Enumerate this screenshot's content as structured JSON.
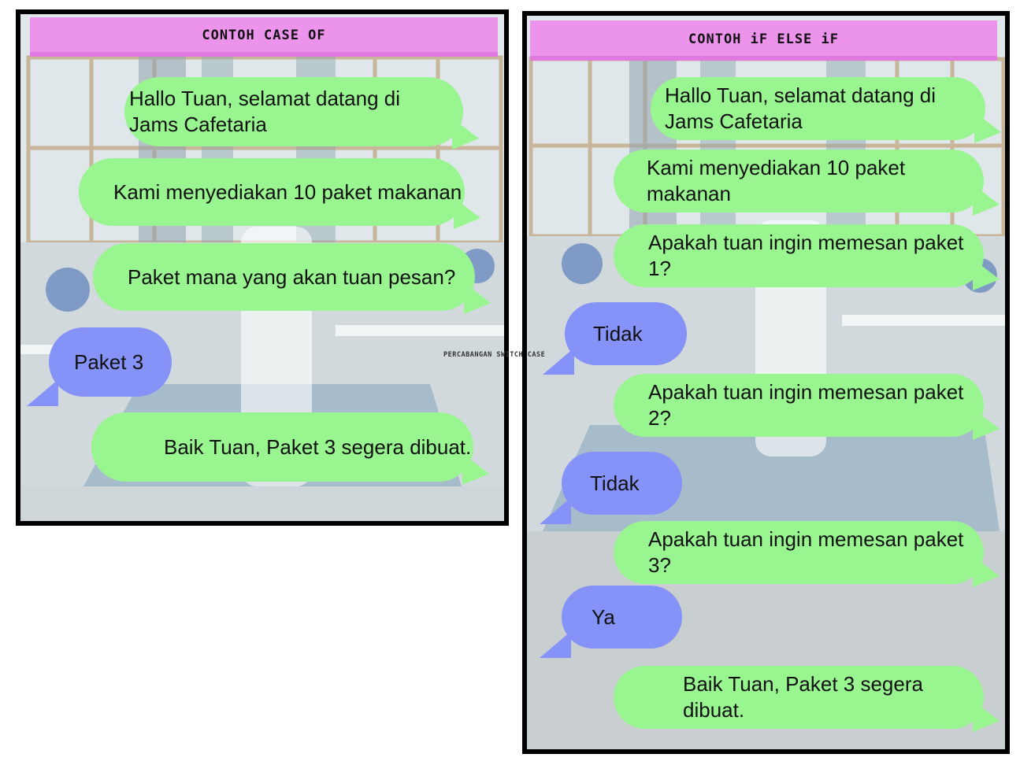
{
  "left_panel": {
    "title": "CONTOH CASE OF",
    "messages": [
      {
        "text": "Hallo Tuan, selamat datang di Jams Cafetaria"
      },
      {
        "text": "Kami menyediakan 10 paket makanan"
      },
      {
        "text": "Paket mana yang akan tuan pesan?"
      },
      {
        "text": "Paket 3"
      },
      {
        "text": "Baik Tuan, Paket 3 segera dibuat."
      }
    ]
  },
  "right_panel": {
    "title": "CONTOH iF ELSE iF",
    "messages": [
      {
        "text": "Hallo Tuan, selamat datang di Jams Cafetaria"
      },
      {
        "text": "Kami menyediakan 10 paket makanan"
      },
      {
        "text": "Apakah tuan ingin memesan paket 1?"
      },
      {
        "text": "Tidak"
      },
      {
        "text": "Apakah tuan ingin memesan paket 2?"
      },
      {
        "text": "Tidak"
      },
      {
        "text": "Apakah tuan ingin memesan paket 3?"
      },
      {
        "text": "Ya"
      },
      {
        "text": "Baik Tuan, Paket 3 segera dibuat."
      }
    ]
  },
  "watermark": "PERCABANGAN SWITCH CASE",
  "colors": {
    "banner": "#ec93ec",
    "bubble_green": "#98f58f",
    "bubble_blue": "#8592f7",
    "frame": "#000000"
  }
}
